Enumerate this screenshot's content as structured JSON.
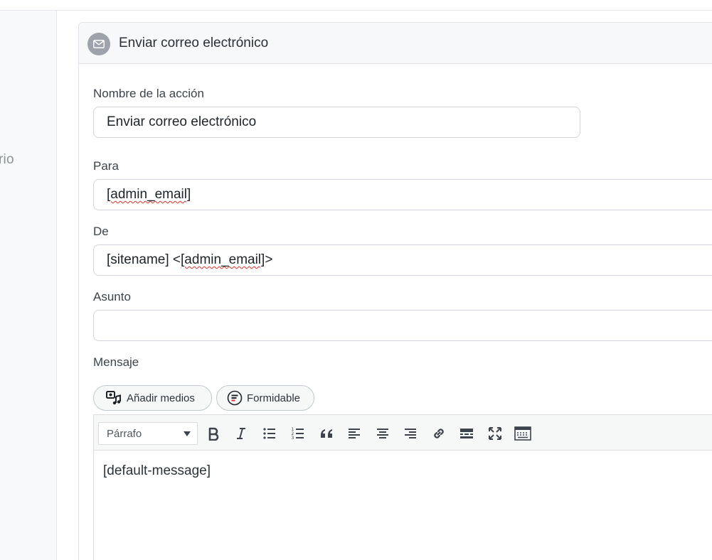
{
  "sidebar": {
    "partial_label": "rio"
  },
  "action": {
    "title": "Enviar correo electrónico",
    "icon": "envelope-icon"
  },
  "form": {
    "name_label": "Nombre de la acción",
    "name_value": "Enviar correo electrónico",
    "to_label": "Para",
    "to_value": "[admin_email]",
    "from_label": "De",
    "from_value_prefix": "[sitename] <",
    "from_value_email": "[admin_email]",
    "from_value_suffix": ">",
    "subject_label": "Asunto",
    "subject_value": "",
    "message_label": "Mensaje"
  },
  "media_buttons": {
    "add_media": "Añadir medios",
    "formidable": "Formidable"
  },
  "editor": {
    "format_selected": "Párrafo",
    "content": "[default-message]",
    "toolbar_icons": [
      "bold-icon",
      "italic-icon",
      "bullet-list-icon",
      "numbered-list-icon",
      "blockquote-icon",
      "align-left-icon",
      "align-center-icon",
      "align-right-icon",
      "link-icon",
      "read-more-icon",
      "fullscreen-icon",
      "toolbar-toggle-icon"
    ]
  }
}
